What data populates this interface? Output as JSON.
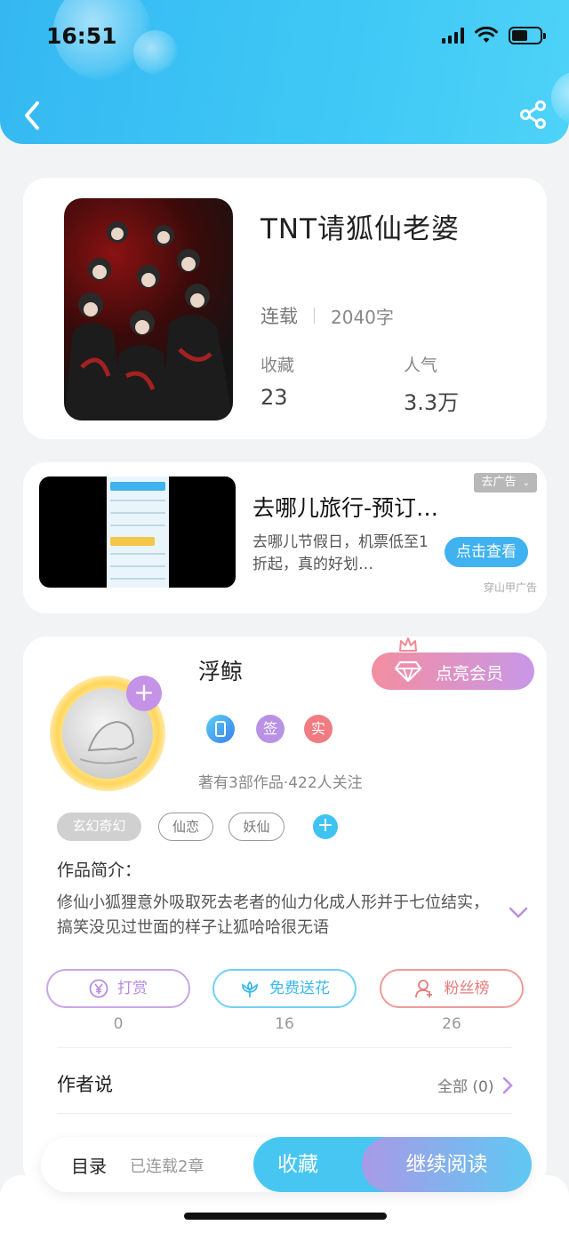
{
  "status_bar": {
    "time": "16:51"
  },
  "book": {
    "title": "TNT请狐仙老婆",
    "status": "连载",
    "word_count": "2040字",
    "favorites_label": "收藏",
    "favorites_value": "23",
    "popularity_label": "人气",
    "popularity_value": "3.3万"
  },
  "ad": {
    "title": "去哪儿旅行-预订…",
    "description": "去哪儿节假日，机票低至1折起，真的好划…",
    "button_label": "点击查看",
    "tag": "去广告",
    "source": "穿山甲广告"
  },
  "author": {
    "name": "浮鲸",
    "vip_button": "点亮会员",
    "badges": [
      {
        "label": "",
        "color": "#4aa6f0"
      },
      {
        "label": "签",
        "color": "#b992e6"
      },
      {
        "label": "实",
        "color": "#f07c82"
      }
    ],
    "works_info": "著有3部作品·422人关注"
  },
  "tags": [
    "玄幻奇幻",
    "仙恋",
    "妖仙"
  ],
  "intro": {
    "heading": "作品简介：",
    "text": "修仙小狐狸意外吸取死去老者的仙力化成人形并于七位结实，搞笑没见过世面的样子让狐哈哈很无语"
  },
  "actions": [
    {
      "label": "打赏",
      "count": "0",
      "color": "#b997e3"
    },
    {
      "label": "免费送花",
      "count": "16",
      "color": "#47c6f1"
    },
    {
      "label": "粉丝榜",
      "count": "26",
      "color": "#ee8a8a"
    }
  ],
  "author_says": {
    "heading": "作者说",
    "all_label": "全部 (0)"
  },
  "bottom_bar": {
    "toc_label": "目录",
    "serial_info": "已连载2章",
    "favorite_button": "收藏",
    "read_button": "继续阅读"
  }
}
